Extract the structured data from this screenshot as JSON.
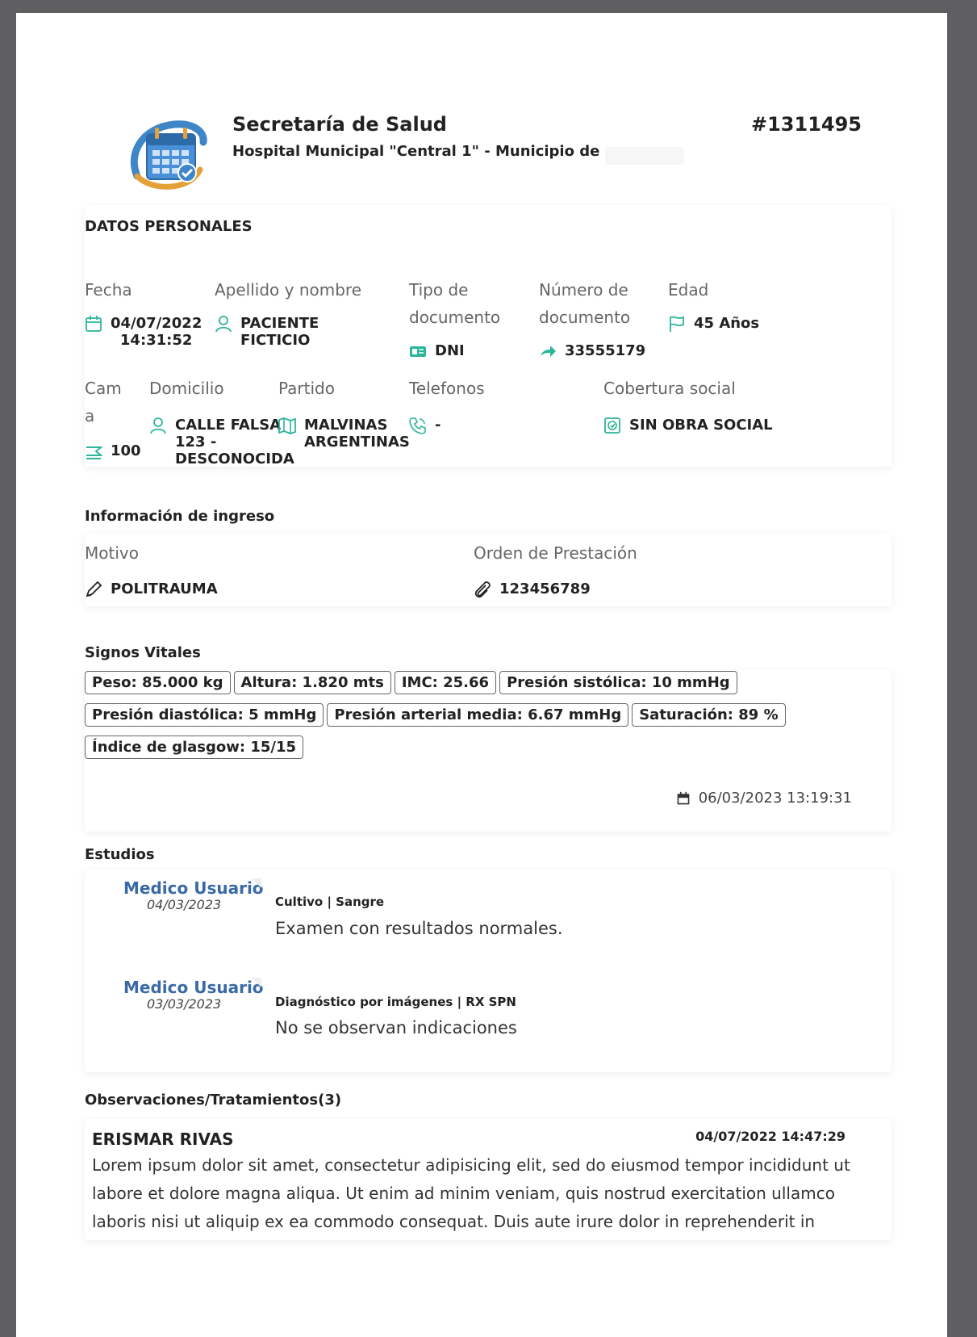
{
  "header": {
    "org_title": "Secretaría de Salud",
    "org_subtitle": "Hospital Municipal \"Central 1\" - Municipio de",
    "record_number": "#1311495"
  },
  "personal": {
    "section_title": "DATOS PERSONALES",
    "fecha_label": "Fecha",
    "fecha_value": "04/07/2022\n14:31:52",
    "nombre_label": "Apellido y nombre",
    "nombre_value": "PACIENTE\nFICTICIO",
    "tipo_doc_label": "Tipo de\ndocumento",
    "tipo_doc_value": "DNI",
    "num_doc_label": "Número de\ndocumento",
    "num_doc_value": "33555179",
    "edad_label": "Edad",
    "edad_value": "45 Años",
    "cama_label": "Cam\na",
    "cama_value": "100",
    "domicilio_label": "Domicilio",
    "domicilio_value": "CALLE FALSA\n123 -\nDESCONOCIDA",
    "partido_label": "Partido",
    "partido_value": "MALVINAS\nARGENTINAS",
    "telefonos_label": "Telefonos",
    "telefonos_value": "-",
    "cobertura_label": "Cobertura social",
    "cobertura_value": "SIN OBRA SOCIAL"
  },
  "ingreso": {
    "section_title": "Información de ingreso",
    "motivo_label": "Motivo",
    "motivo_value": "POLITRAUMA",
    "orden_label": "Orden de Prestación",
    "orden_value": "123456789"
  },
  "vitales": {
    "section_title": "Signos Vitales",
    "rows": [
      [
        "Peso: 85.000 kg",
        "Altura: 1.820 mts",
        "IMC: 25.66",
        "Presión sistólica: 10 mmHg"
      ],
      [
        "Presión diastólica: 5 mmHg",
        "Presión arterial media: 6.67 mmHg",
        "Saturación: 89 %"
      ],
      [
        "Índice de glasgow: 15/15"
      ]
    ],
    "timestamp": "06/03/2023 13:19:31"
  },
  "estudios": {
    "section_title": "Estudios",
    "items": [
      {
        "author": "Medico Usuario",
        "date": "04/03/2023",
        "type": "Cultivo | Sangre",
        "result": "Examen con resultados normales."
      },
      {
        "author": "Medico Usuario",
        "date": "03/03/2023",
        "type": "Diagnóstico por imágenes | RX SPN",
        "result": "No se observan indicaciones"
      }
    ]
  },
  "observaciones": {
    "section_title": "Observaciones/Tratamientos(3)",
    "author": "ERISMAR RIVAS",
    "date": "04/07/2022 14:47:29",
    "lines": [
      "Lorem ipsum dolor sit amet, consectetur adipisicing elit, sed do eiusmod tempor incididunt ut",
      "labore et dolore magna aliqua. Ut enim ad minim veniam, quis nostrud exercitation ullamco",
      "laboris nisi ut aliquip ex ea commodo consequat. Duis aute irure dolor in reprehenderit in"
    ]
  },
  "colors": {
    "accent_teal": "#2bb59a",
    "author_blue": "#3a6aa6",
    "page_bg": "#5f5f62"
  },
  "icons": [
    "calendar-icon",
    "user-icon",
    "id-card-icon",
    "share-icon",
    "flag-icon",
    "bed-icon",
    "map-pin-user-icon",
    "map-icon",
    "phone-icon",
    "medical-box-icon",
    "pencil-icon",
    "paperclip-icon",
    "calendar-small-icon"
  ]
}
